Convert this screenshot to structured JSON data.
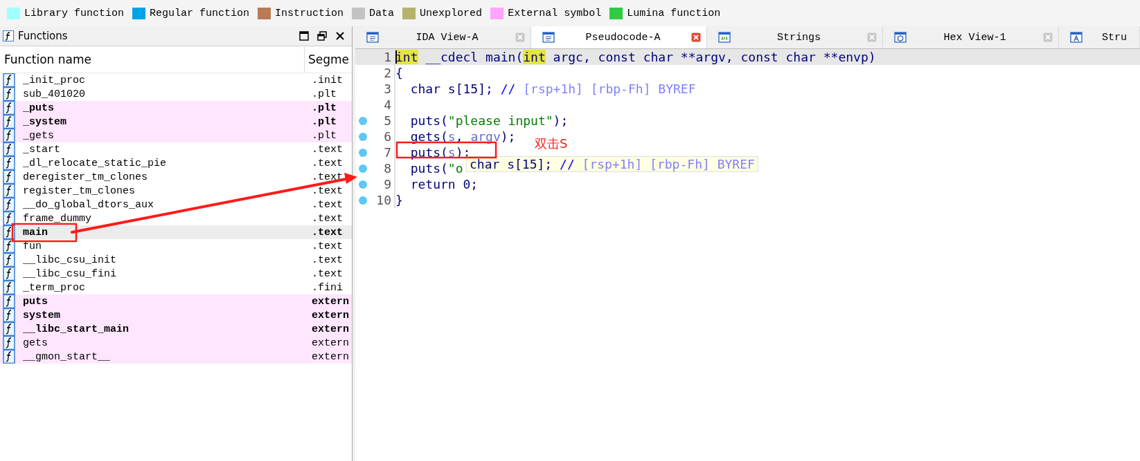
{
  "legend": [
    {
      "label": "Library function",
      "color": "#a0ffff"
    },
    {
      "label": "Regular function",
      "color": "#00a2e8"
    },
    {
      "label": "Instruction",
      "color": "#b97a57"
    },
    {
      "label": "Data",
      "color": "#c3c3c3"
    },
    {
      "label": "Unexplored",
      "color": "#b5b26b"
    },
    {
      "label": "External symbol",
      "color": "#ffa6ff"
    },
    {
      "label": "Lumina function",
      "color": "#2ecc40"
    }
  ],
  "functions_panel": {
    "title": "Functions",
    "columns": [
      "Function name",
      "Segme"
    ],
    "rows": [
      {
        "name": "_init_proc",
        "segment": ".init",
        "bold": false,
        "external": false,
        "selected": false
      },
      {
        "name": "sub_401020",
        "segment": ".plt",
        "bold": false,
        "external": false,
        "selected": false
      },
      {
        "name": "_puts",
        "segment": ".plt",
        "bold": true,
        "external": true,
        "selected": false
      },
      {
        "name": "_system",
        "segment": ".plt",
        "bold": true,
        "external": true,
        "selected": false
      },
      {
        "name": "_gets",
        "segment": ".plt",
        "bold": false,
        "external": true,
        "selected": false
      },
      {
        "name": "_start",
        "segment": ".text",
        "bold": false,
        "external": false,
        "selected": false
      },
      {
        "name": "_dl_relocate_static_pie",
        "segment": ".text",
        "bold": false,
        "external": false,
        "selected": false
      },
      {
        "name": "deregister_tm_clones",
        "segment": ".text",
        "bold": false,
        "external": false,
        "selected": false
      },
      {
        "name": "register_tm_clones",
        "segment": ".text",
        "bold": false,
        "external": false,
        "selected": false
      },
      {
        "name": "__do_global_dtors_aux",
        "segment": ".text",
        "bold": false,
        "external": false,
        "selected": false
      },
      {
        "name": "frame_dummy",
        "segment": ".text",
        "bold": false,
        "external": false,
        "selected": false
      },
      {
        "name": "main",
        "segment": ".text",
        "bold": true,
        "external": false,
        "selected": true
      },
      {
        "name": "fun",
        "segment": ".text",
        "bold": false,
        "external": false,
        "selected": false
      },
      {
        "name": "__libc_csu_init",
        "segment": ".text",
        "bold": false,
        "external": false,
        "selected": false
      },
      {
        "name": "__libc_csu_fini",
        "segment": ".text",
        "bold": false,
        "external": false,
        "selected": false
      },
      {
        "name": "_term_proc",
        "segment": ".fini",
        "bold": false,
        "external": false,
        "selected": false
      },
      {
        "name": "puts",
        "segment": "extern",
        "bold": true,
        "external": true,
        "selected": false
      },
      {
        "name": "system",
        "segment": "extern",
        "bold": true,
        "external": true,
        "selected": false
      },
      {
        "name": "__libc_start_main",
        "segment": "extern",
        "bold": true,
        "external": true,
        "selected": false
      },
      {
        "name": "gets",
        "segment": "extern",
        "bold": false,
        "external": true,
        "selected": false
      },
      {
        "name": "__gmon_start__",
        "segment": "extern",
        "bold": false,
        "external": true,
        "selected": false
      }
    ]
  },
  "tabs": [
    {
      "label": "IDA View-A",
      "kind": "disasm",
      "selected": false,
      "closable": true
    },
    {
      "label": "Pseudocode-A",
      "kind": "pseudo",
      "selected": true,
      "closable": true
    },
    {
      "label": "Strings",
      "kind": "strings",
      "selected": false,
      "closable": true
    },
    {
      "label": "Hex View-1",
      "kind": "hex",
      "selected": false,
      "closable": true
    },
    {
      "label": "Stru",
      "kind": "struct",
      "selected": false,
      "closable": false
    }
  ],
  "code": [
    {
      "number": "1",
      "current": true,
      "dot": false,
      "tokens": [
        {
          "t": "int",
          "kind": "hl"
        },
        {
          "t": " __cdecl main(",
          "kind": "kw"
        },
        {
          "t": "int",
          "kind": "hl"
        },
        {
          "t": " argc, const char **argv, const char **envp)",
          "kind": "kw"
        }
      ]
    },
    {
      "number": "2",
      "current": false,
      "dot": false,
      "tokens": [
        {
          "t": "{",
          "kind": "kw"
        }
      ]
    },
    {
      "number": "3",
      "current": false,
      "dot": false,
      "tokens": [
        {
          "t": "  char s[15]; ",
          "kind": "kw"
        },
        {
          "t": "//",
          "kind": "slash"
        },
        {
          "t": " [rsp+1h] [rbp-Fh] BYREF",
          "kind": "cmt"
        }
      ]
    },
    {
      "number": "4",
      "current": false,
      "dot": false
    },
    {
      "number": "5",
      "current": false,
      "dot": true,
      "tokens": [
        {
          "t": "  puts(",
          "kind": "kw"
        },
        {
          "t": "\"please input\"",
          "kind": "str"
        },
        {
          "t": ");",
          "kind": "kw"
        }
      ]
    },
    {
      "number": "6",
      "current": false,
      "dot": true,
      "tokens": [
        {
          "t": "  gets(",
          "kind": "kw"
        },
        {
          "t": "s",
          "kind": "var"
        },
        {
          "t": ", ",
          "kind": "kw"
        },
        {
          "t": "argv",
          "kind": "var"
        },
        {
          "t": ");",
          "kind": "kw"
        }
      ]
    },
    {
      "number": "7",
      "current": false,
      "dot": true,
      "tokens": [
        {
          "t": "  puts(",
          "kind": "kw"
        },
        {
          "t": "s",
          "kind": "var"
        },
        {
          "t": ");",
          "kind": "kw"
        }
      ]
    },
    {
      "number": "8",
      "current": false,
      "dot": true,
      "tokens": [
        {
          "t": "  puts(",
          "kind": "kw"
        },
        {
          "t": "\"o",
          "kind": "str"
        }
      ]
    },
    {
      "number": "9",
      "current": false,
      "dot": true,
      "tokens": [
        {
          "t": "  return 0;",
          "kind": "kw"
        }
      ]
    },
    {
      "number": "10",
      "current": false,
      "dot": true,
      "tokens": [
        {
          "t": "}",
          "kind": "kw"
        }
      ]
    }
  ],
  "tooltip": {
    "tokens": [
      {
        "t": "char s[15]; ",
        "kind": "kw"
      },
      {
        "t": "//",
        "kind": "slash"
      },
      {
        "t": " [rsp+1h] [rbp-Fh] BYREF",
        "kind": "cmt"
      }
    ]
  },
  "annotation": {
    "text": "双击S"
  }
}
